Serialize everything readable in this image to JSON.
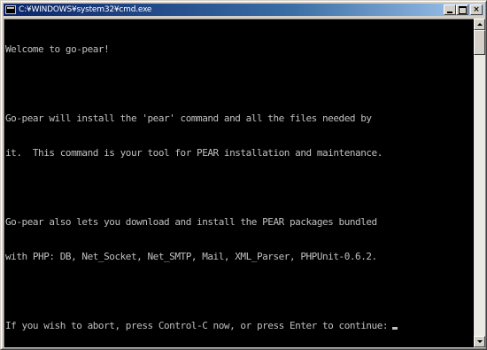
{
  "window": {
    "title": "C:¥WINDOWS¥system32¥cmd.exe",
    "icon": "console-icon",
    "buttons": {
      "minimize": "minimize-icon",
      "maximize": "maximize-icon",
      "close": "×"
    }
  },
  "console": {
    "lines": [
      "Welcome to go-pear!",
      "",
      "Go-pear will install the 'pear' command and all the files needed by",
      "it.  This command is your tool for PEAR installation and maintenance.",
      "",
      "Go-pear also lets you download and install the PEAR packages bundled",
      "with PHP: DB, Net_Socket, Net_SMTP, Mail, XML_Parser, PHPUnit-0.6.2.",
      "",
      "If you wish to abort, press Control-C now, or press Enter to continue:"
    ],
    "text_color": "#c0c0c0",
    "background": "#000000"
  },
  "scrollbar": {
    "position": 0
  }
}
